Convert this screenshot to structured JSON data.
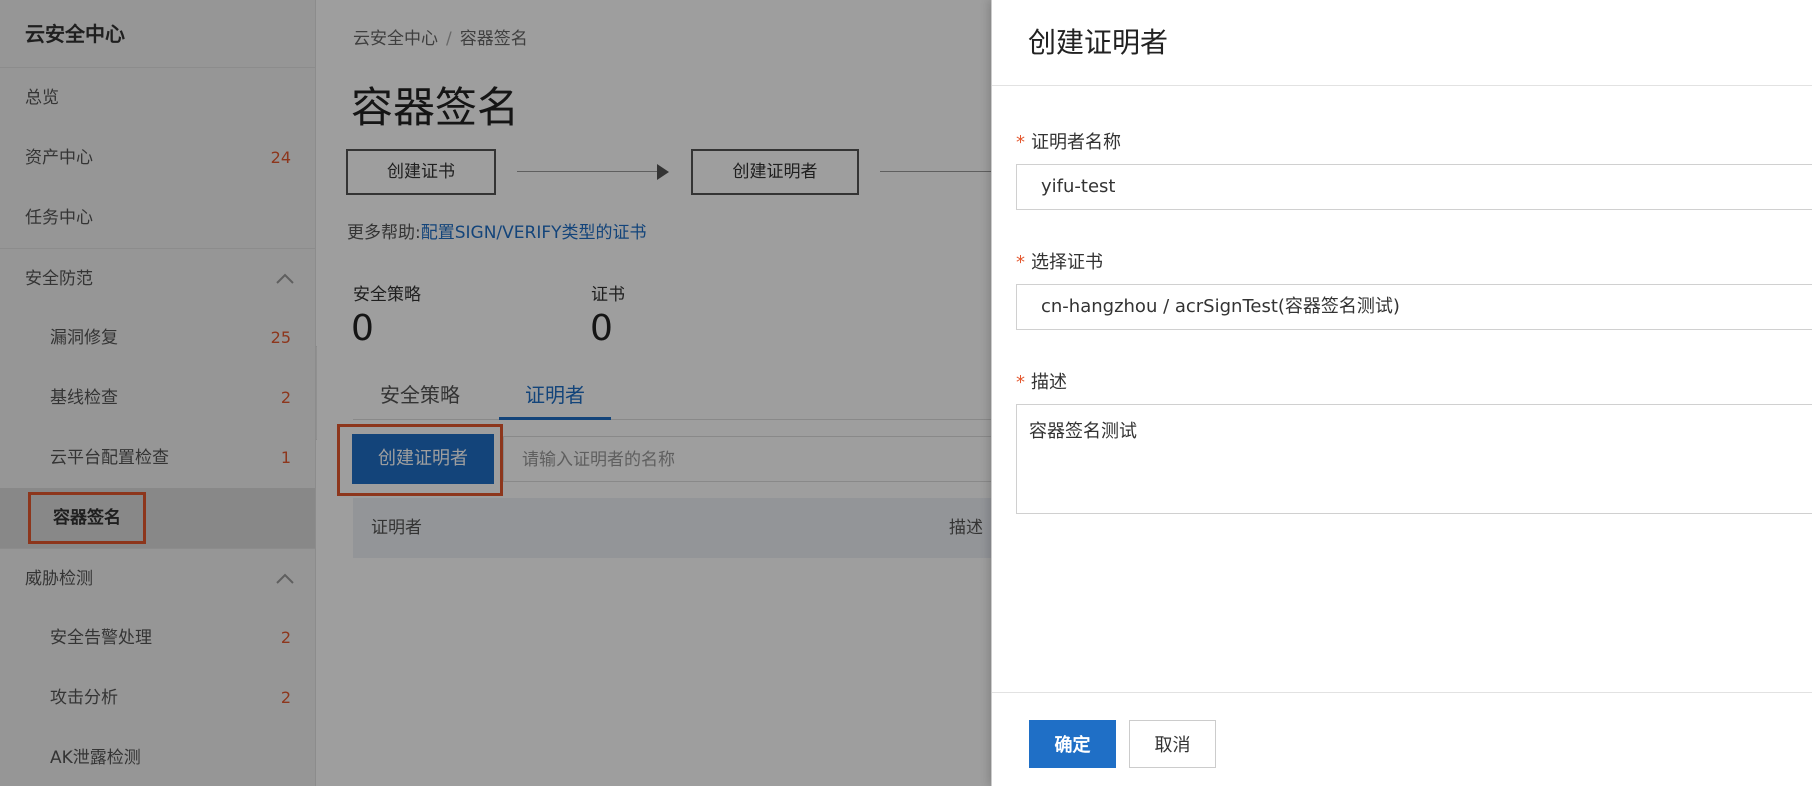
{
  "sidebar": {
    "title": "云安全中心",
    "items": [
      {
        "label": "总览",
        "count": ""
      },
      {
        "label": "资产中心",
        "count": "24"
      },
      {
        "label": "任务中心",
        "count": ""
      },
      {
        "label": "安全防范",
        "count": ""
      },
      {
        "label": "漏洞修复",
        "count": "25"
      },
      {
        "label": "基线检查",
        "count": "2"
      },
      {
        "label": "云平台配置检查",
        "count": "1"
      },
      {
        "label": "容器签名",
        "count": ""
      },
      {
        "label": "威胁检测",
        "count": ""
      },
      {
        "label": "安全告警处理",
        "count": "2"
      },
      {
        "label": "攻击分析",
        "count": "2"
      },
      {
        "label": "AK泄露检测",
        "count": ""
      }
    ]
  },
  "breadcrumb": {
    "root": "云安全中心",
    "sep": "/",
    "current": "容器签名"
  },
  "page_title": "容器签名",
  "steps": {
    "step1": "创建证书",
    "step2": "创建证明者"
  },
  "help": {
    "prefix": "更多帮助:",
    "link": "配置SIGN/VERIFY类型的证书"
  },
  "stats": [
    {
      "label": "安全策略",
      "value": "0"
    },
    {
      "label": "证书",
      "value": "0"
    }
  ],
  "tabs": [
    {
      "label": "安全策略"
    },
    {
      "label": "证明者"
    }
  ],
  "create_button": "创建证明者",
  "search": {
    "placeholder": "请输入证明者的名称"
  },
  "table": {
    "columns": [
      "证明者",
      "描述"
    ]
  },
  "drawer": {
    "title": "创建证明者",
    "required_mark": "*",
    "name_label": "证明者名称",
    "name_value": "yifu-test",
    "cert_label": "选择证书",
    "cert_value": "cn-hangzhou / acrSignTest(容器签名测试)",
    "desc_label": "描述",
    "desc_value": "容器签名测试",
    "ok": "确定",
    "cancel": "取消"
  },
  "colors": {
    "accent": "#1f6fc6",
    "highlight": "#e4572e",
    "count": "#e4572e"
  }
}
